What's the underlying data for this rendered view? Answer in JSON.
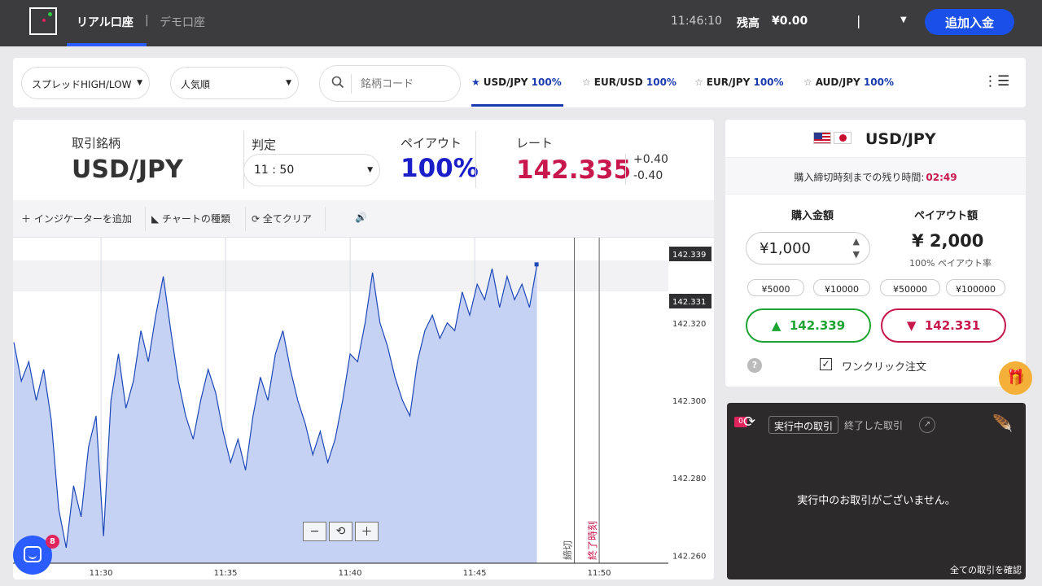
{
  "topbar": {
    "account_real": "リアル口座",
    "account_separator": "|",
    "account_demo": "デモ口座",
    "clock": "11:46:10",
    "balance_label": "残高",
    "balance_value": "¥0.00",
    "separator": "|",
    "deposit_label": "追加入金"
  },
  "filters": {
    "sort_spread": "スプレッドHIGH/LOW",
    "sort_popular": "人気順",
    "search_placeholder": "銘柄コード",
    "favorites": [
      {
        "symbol": "USD/JPY",
        "payout": "100%"
      },
      {
        "symbol": "EUR/USD",
        "payout": "100%"
      },
      {
        "symbol": "EUR/JPY",
        "payout": "100%"
      },
      {
        "symbol": "AUD/JPY",
        "payout": "100%"
      }
    ]
  },
  "instrument": {
    "label_symbol": "取引銘柄",
    "symbol": "USD/JPY",
    "label_judge": "判定",
    "judge_time": "11 : 50",
    "label_payout": "ペイアウト",
    "payout": "100%",
    "label_rate": "レート",
    "rate": "142.335",
    "rate_up": "+0.40",
    "rate_down": "-0.40"
  },
  "chart_toolbar": {
    "add_indicator": "インジケーターを追加",
    "chart_type": "チャートの種類",
    "clear_all": "全てクリア"
  },
  "chart_data": {
    "type": "area",
    "x_ticks": [
      "11:30",
      "11:35",
      "11:40",
      "11:45",
      "11:50"
    ],
    "y_ticks": [
      "142.320",
      "142.300",
      "142.280",
      "142.260"
    ],
    "ylim": [
      142.258,
      142.342
    ],
    "price_tags": {
      "high": "142.339",
      "low": "142.331"
    },
    "last_value": 142.335,
    "markers": [
      {
        "label": "締切",
        "time": "11:49"
      },
      {
        "label": "終了時刻",
        "time": "11:50"
      }
    ],
    "series": [
      {
        "time_minutes": [
          0,
          0.3,
          0.6,
          0.9,
          1.2,
          1.5,
          1.8,
          2.1,
          2.4,
          2.7,
          3.0,
          3.3,
          3.6,
          3.9,
          4.2,
          4.5,
          4.8,
          5.1,
          5.4,
          5.7,
          6.0,
          6.3,
          6.6,
          6.9,
          7.2,
          7.5,
          7.8,
          8.1,
          8.4,
          8.7,
          9.0,
          9.3,
          9.6,
          9.9,
          10.2,
          10.5,
          10.8,
          11.1,
          11.4,
          11.7,
          12.0,
          12.3,
          12.6,
          12.9,
          13.2,
          13.5,
          13.8,
          14.1,
          14.4,
          14.7,
          15.0,
          15.3,
          15.6,
          15.9,
          16.2,
          16.5,
          16.8,
          17.1,
          17.4,
          17.7,
          18.0,
          18.3,
          18.6,
          18.9,
          19.2,
          19.5,
          19.8,
          20.1,
          20.4,
          20.7,
          21.0
        ],
        "values": [
          142.315,
          142.305,
          142.31,
          142.3,
          142.308,
          142.295,
          142.272,
          142.262,
          142.278,
          142.27,
          142.288,
          142.296,
          142.265,
          142.3,
          142.312,
          142.298,
          142.305,
          142.318,
          142.31,
          142.322,
          142.332,
          142.318,
          142.305,
          142.296,
          142.29,
          142.3,
          142.308,
          142.302,
          142.292,
          142.284,
          142.29,
          142.282,
          142.296,
          142.306,
          142.3,
          142.312,
          142.318,
          142.308,
          142.3,
          142.294,
          142.286,
          142.292,
          142.284,
          142.29,
          142.3,
          142.312,
          142.31,
          142.32,
          142.333,
          142.32,
          142.314,
          142.306,
          142.3,
          142.296,
          142.31,
          142.318,
          142.322,
          142.316,
          142.32,
          142.318,
          142.328,
          142.322,
          142.33,
          142.326,
          142.334,
          142.324,
          142.332,
          142.326,
          142.33,
          142.324,
          142.335
        ]
      }
    ]
  },
  "trade_panel": {
    "symbol": "USD/JPY",
    "cutoff_label": "購入締切時刻までの残り時間:",
    "cutoff_time": "02:49",
    "amount_label": "購入金額",
    "amount_value": "¥1,000",
    "payout_label": "ペイアウト額",
    "payout_amount": "¥ 2,000",
    "payout_rate": "100% ペイアウト率",
    "presets": [
      "¥5000",
      "¥10000",
      "¥50000",
      "¥100000"
    ],
    "high_rate": "142.339",
    "low_rate": "142.331",
    "help": "?",
    "one_click_label": "ワンクリック注文"
  },
  "positions": {
    "badge_count": "0",
    "tab_active": "実行中の取引",
    "tab_closed": "終了した取引",
    "empty_message": "実行中のお取引がございません。",
    "view_all": "全ての取引を確認"
  },
  "chat": {
    "badge": "8"
  },
  "colors": {
    "accent": "#1a4fe8",
    "high": "#1ea432",
    "low": "#c8174c",
    "payout": "#1a1fc8",
    "chart_fill": "#c3d0f2",
    "chart_line": "#1c47b8"
  }
}
